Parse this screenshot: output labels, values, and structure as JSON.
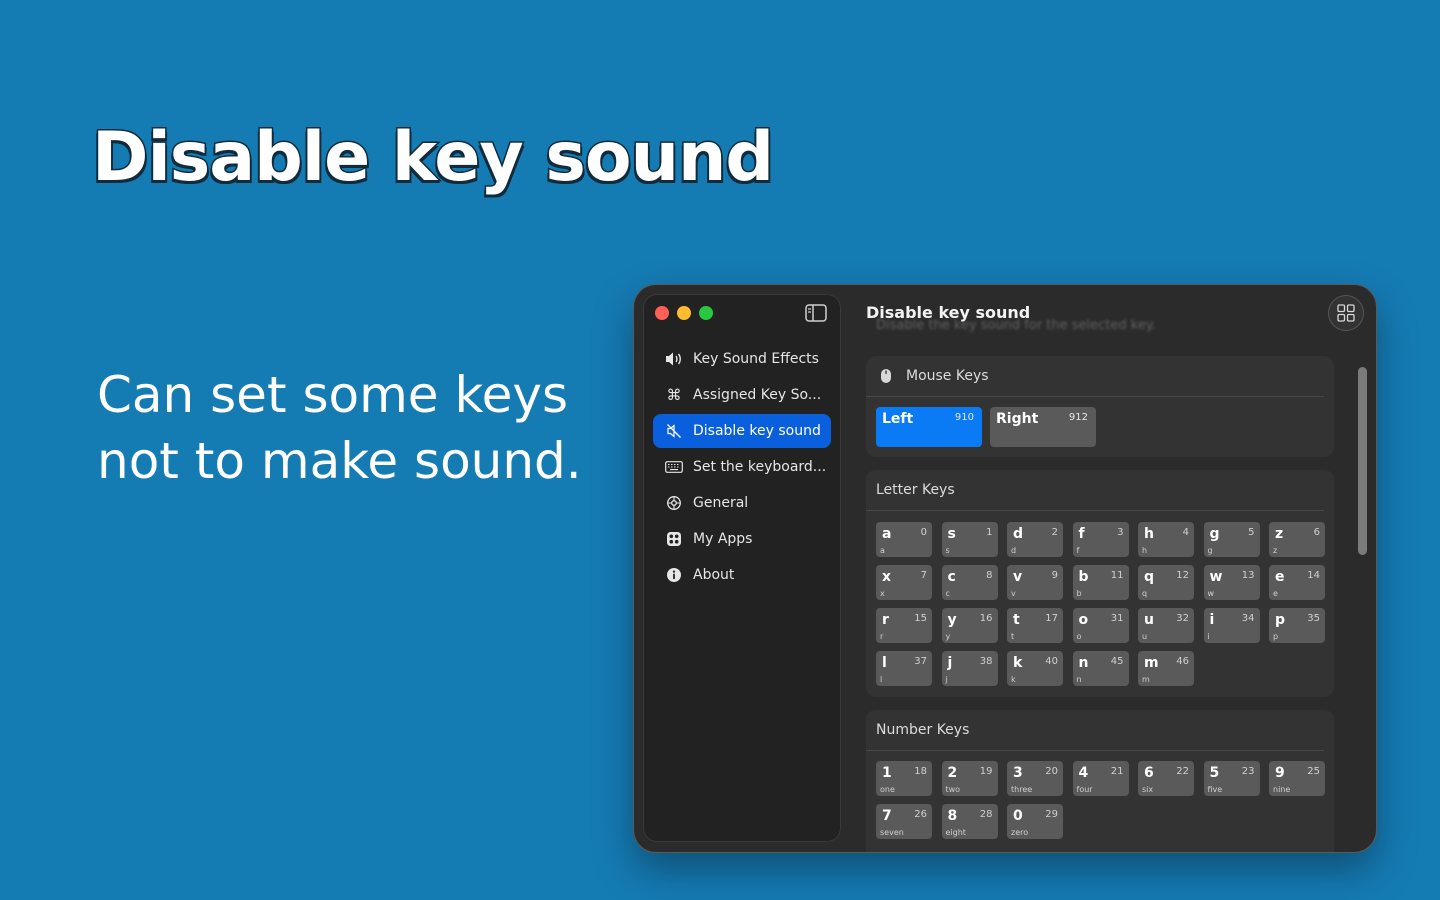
{
  "promo": {
    "headline": "Disable key sound",
    "subline": "Can set some keys not to make sound."
  },
  "sidebar": {
    "items": [
      {
        "label": "Key Sound Effects",
        "icon": "speaker-icon",
        "active": false
      },
      {
        "label": "Assigned Key So...",
        "icon": "command-icon",
        "active": false
      },
      {
        "label": "Disable key sound",
        "icon": "speaker-slash-icon",
        "active": true
      },
      {
        "label": "Set the keyboard...",
        "icon": "keyboard-icon",
        "active": false
      },
      {
        "label": "General",
        "icon": "gear-icon",
        "active": false
      },
      {
        "label": "My Apps",
        "icon": "apps-icon",
        "active": false
      },
      {
        "label": "About",
        "icon": "info-icon",
        "active": false
      }
    ]
  },
  "main": {
    "title": "Disable key sound",
    "subtitle": "Disable the key sound for the selected key."
  },
  "mouse_keys": {
    "title": "Mouse Keys",
    "keys": [
      {
        "label": "Left",
        "code": "910",
        "selected": true
      },
      {
        "label": "Right",
        "code": "912",
        "selected": false
      }
    ]
  },
  "letter_keys": {
    "title": "Letter Keys",
    "keys": [
      {
        "label": "a",
        "code": "0",
        "sub": "a"
      },
      {
        "label": "s",
        "code": "1",
        "sub": "s"
      },
      {
        "label": "d",
        "code": "2",
        "sub": "d"
      },
      {
        "label": "f",
        "code": "3",
        "sub": "f"
      },
      {
        "label": "h",
        "code": "4",
        "sub": "h"
      },
      {
        "label": "g",
        "code": "5",
        "sub": "g"
      },
      {
        "label": "z",
        "code": "6",
        "sub": "z"
      },
      {
        "label": "x",
        "code": "7",
        "sub": "x"
      },
      {
        "label": "c",
        "code": "8",
        "sub": "c"
      },
      {
        "label": "v",
        "code": "9",
        "sub": "v"
      },
      {
        "label": "b",
        "code": "11",
        "sub": "b"
      },
      {
        "label": "q",
        "code": "12",
        "sub": "q"
      },
      {
        "label": "w",
        "code": "13",
        "sub": "w"
      },
      {
        "label": "e",
        "code": "14",
        "sub": "e"
      },
      {
        "label": "r",
        "code": "15",
        "sub": "r"
      },
      {
        "label": "y",
        "code": "16",
        "sub": "y"
      },
      {
        "label": "t",
        "code": "17",
        "sub": "t"
      },
      {
        "label": "o",
        "code": "31",
        "sub": "o"
      },
      {
        "label": "u",
        "code": "32",
        "sub": "u"
      },
      {
        "label": "i",
        "code": "34",
        "sub": "i"
      },
      {
        "label": "p",
        "code": "35",
        "sub": "p"
      },
      {
        "label": "l",
        "code": "37",
        "sub": "l"
      },
      {
        "label": "j",
        "code": "38",
        "sub": "j"
      },
      {
        "label": "k",
        "code": "40",
        "sub": "k"
      },
      {
        "label": "n",
        "code": "45",
        "sub": "n"
      },
      {
        "label": "m",
        "code": "46",
        "sub": "m"
      }
    ]
  },
  "number_keys": {
    "title": "Number Keys",
    "keys": [
      {
        "label": "1",
        "code": "18",
        "sub": "one"
      },
      {
        "label": "2",
        "code": "19",
        "sub": "two"
      },
      {
        "label": "3",
        "code": "20",
        "sub": "three"
      },
      {
        "label": "4",
        "code": "21",
        "sub": "four"
      },
      {
        "label": "6",
        "code": "22",
        "sub": "six"
      },
      {
        "label": "5",
        "code": "23",
        "sub": "five"
      },
      {
        "label": "9",
        "code": "25",
        "sub": "nine"
      },
      {
        "label": "7",
        "code": "26",
        "sub": "seven"
      },
      {
        "label": "8",
        "code": "28",
        "sub": "eight"
      },
      {
        "label": "0",
        "code": "29",
        "sub": "zero"
      }
    ]
  },
  "colors": {
    "background": "#157bb3",
    "accent": "#0a60dc",
    "key": "#5a5a5a",
    "mouse_selected": "#0a7af5"
  }
}
